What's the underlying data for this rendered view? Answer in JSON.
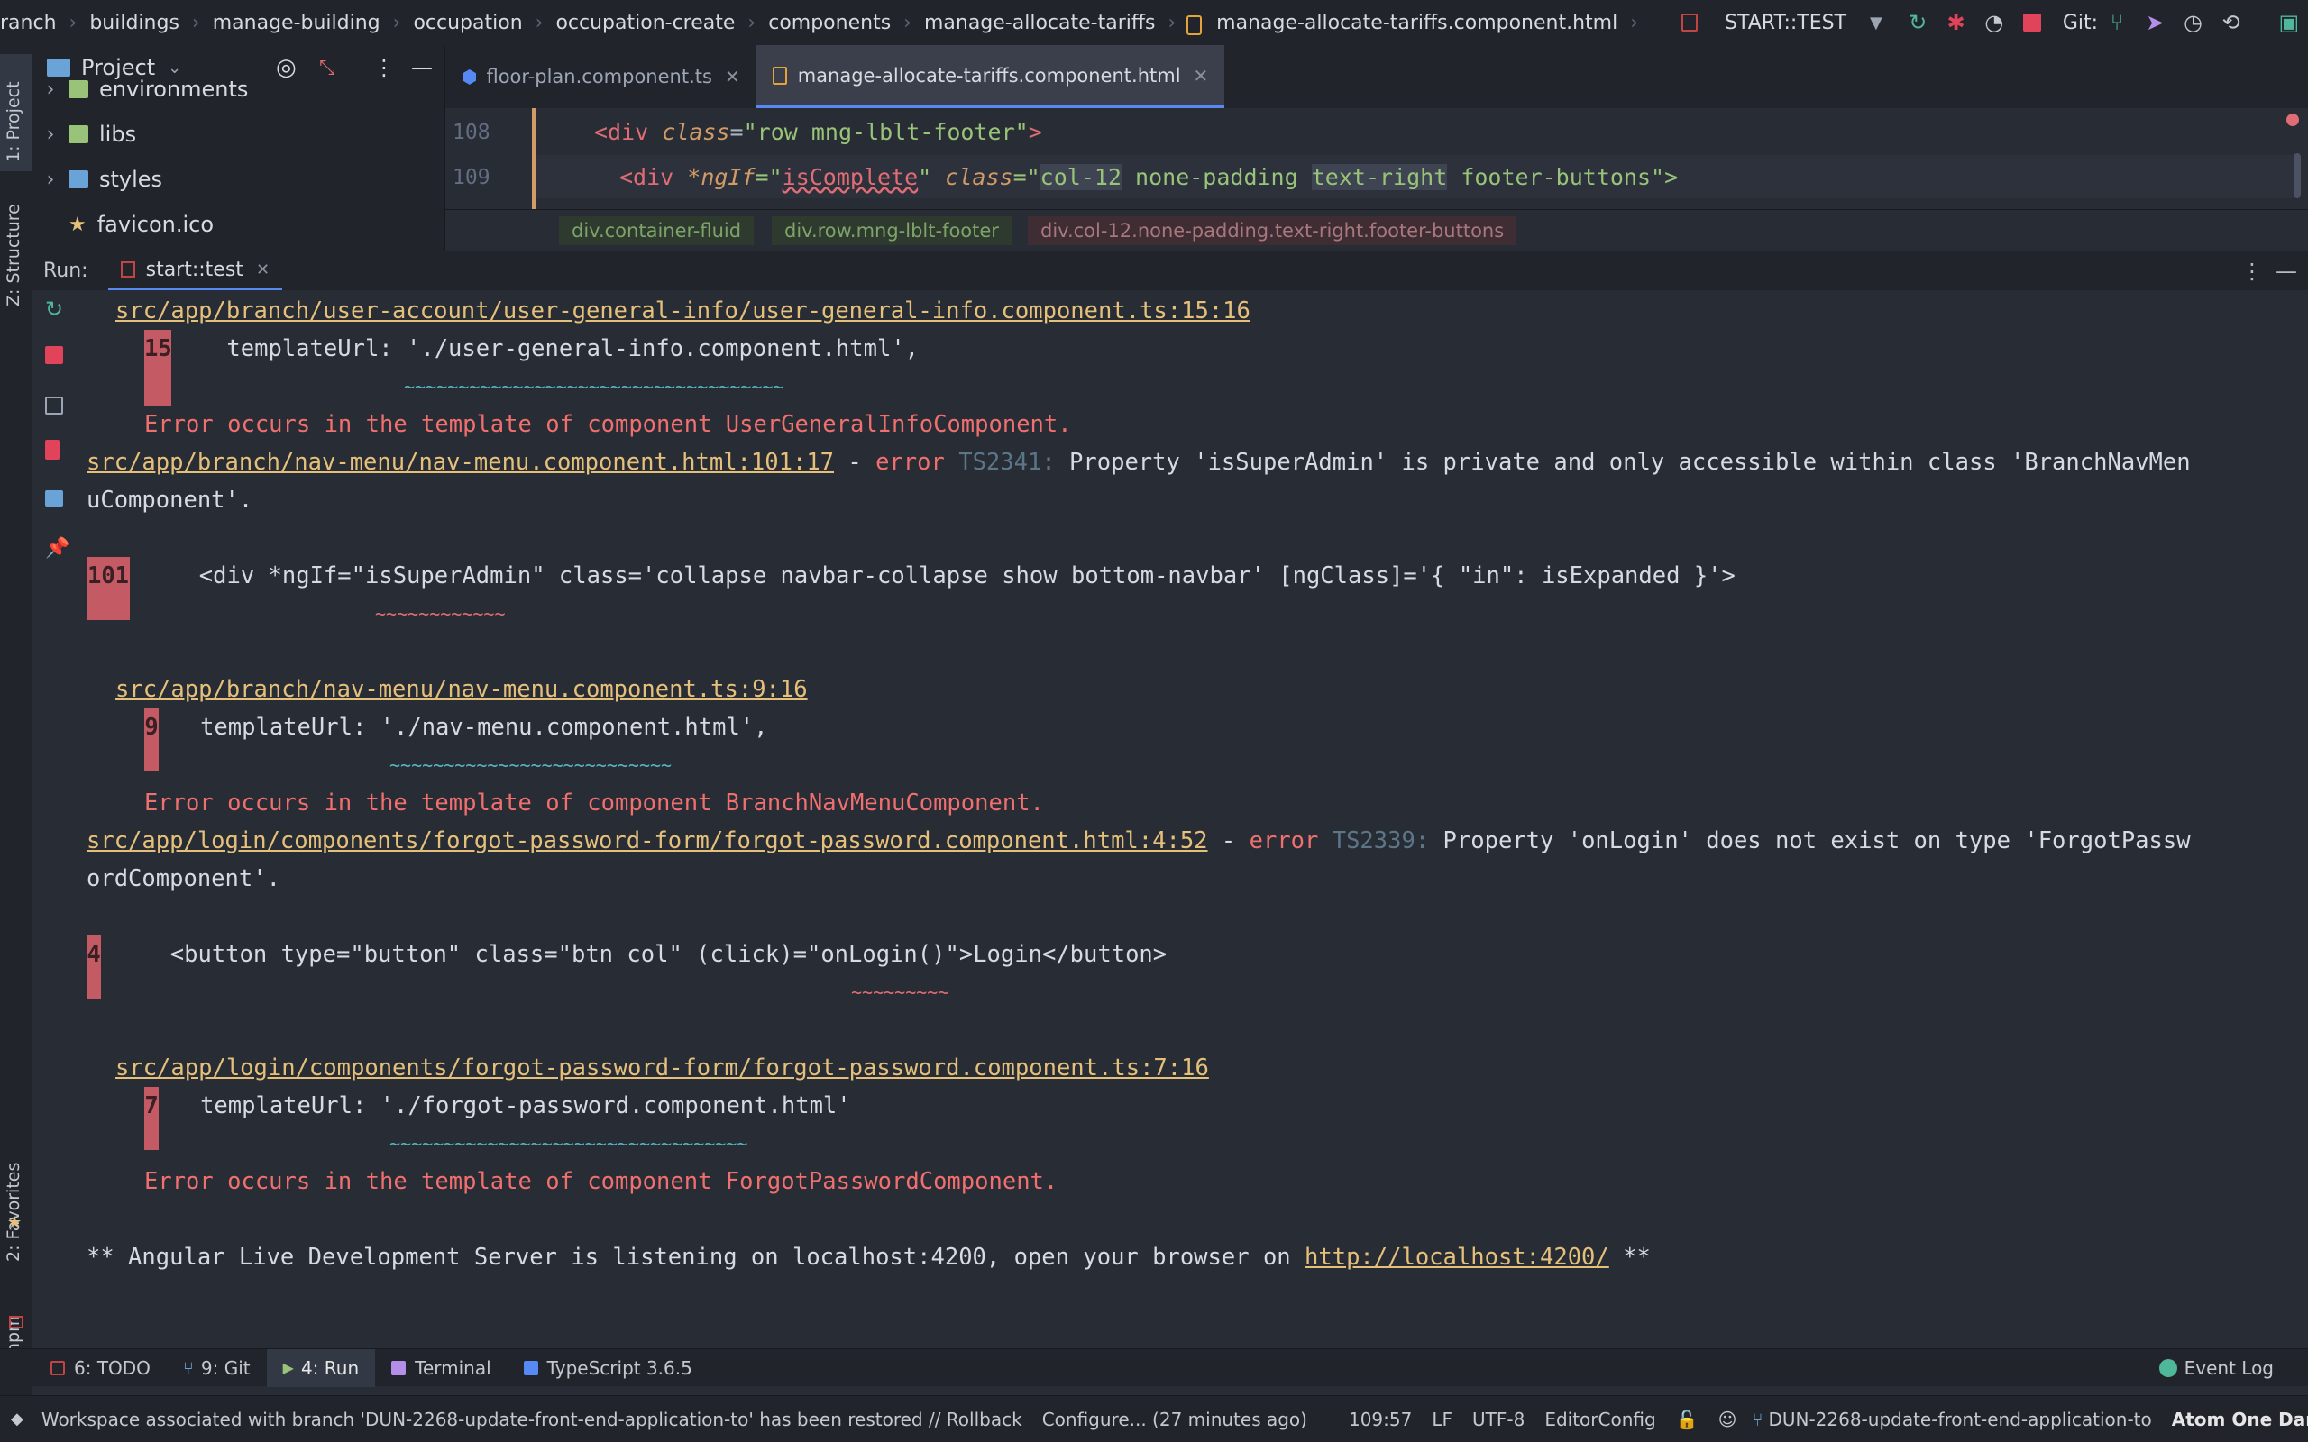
{
  "navbar": {
    "crumbs": [
      "ranch",
      "buildings",
      "manage-building",
      "occupation",
      "occupation-create",
      "components",
      "manage-allocate-tariffs",
      "manage-allocate-tariffs.component.html"
    ],
    "run_config": "START::TEST",
    "git_label": "Git:"
  },
  "left_strip": {
    "project": "1: Project",
    "structure": "Z: Structure",
    "favorites": "2: Favorites",
    "npm": "npm"
  },
  "project_panel": {
    "title": "Project",
    "items": [
      {
        "label": "environments",
        "color": "#98c379"
      },
      {
        "label": "libs",
        "color": "#98c379"
      },
      {
        "label": "styles",
        "color": "#6aa3d8"
      },
      {
        "label": "favicon.ico",
        "color": "#e5c07b"
      }
    ]
  },
  "editor": {
    "tabs": [
      {
        "label": "floor-plan.component.ts",
        "active": false
      },
      {
        "label": "manage-allocate-tariffs.component.html",
        "active": true
      }
    ],
    "lines": [
      {
        "no": "108",
        "tag": "<div",
        "attr1": "class",
        "eq1": "=",
        "val1": "\"row mng-lblt-footer\"",
        "close": ">"
      },
      {
        "no": "109",
        "tag": "<div",
        "attr1": "*ngIf",
        "eq1": "=\"",
        "err": "isComplete",
        "q": "\"",
        "attr2": "class",
        "eq2": "=\"",
        "c1": "col-12",
        "c2": "none-padding",
        "c3": "text-right",
        "c4": "footer-buttons",
        "close": "\">"
      }
    ],
    "breadcrumbs": [
      "div.container-fluid",
      "div.row.mng-lblt-footer",
      "div.col-12.none-padding.text-right.footer-buttons"
    ]
  },
  "run_panel": {
    "label": "Run:",
    "tab": "start::test"
  },
  "console": {
    "l1": "src/app/branch/user-account/user-general-info/user-general-info.component.ts:15:16",
    "l2_no": "15",
    "l2": "templateUrl: './user-general-info.component.html',",
    "l3": "~~~~~~~~~~~~~~~~~~~~~~~~~~~~~~~~~~~",
    "l4": "Error occurs in the template of component UserGeneralInfoComponent.",
    "l5_link": "src/app/branch/nav-menu/nav-menu.component.html:101:17",
    "l5_dash": " - ",
    "l5_err": "error",
    "l5_code": " TS2341:",
    "l5_msg": " Property 'isSuperAdmin' is private and only accessible within class 'BranchNavMen",
    "l6": "uComponent'.",
    "l7_no": "101",
    "l7": "<div *ngIf=\"isSuperAdmin\" class='collapse navbar-collapse show bottom-navbar' [ngClass]='{ \"in\": isExpanded }'>",
    "l8": "~~~~~~~~~~~~",
    "l9": "src/app/branch/nav-menu/nav-menu.component.ts:9:16",
    "l10_no": "9",
    "l10": "templateUrl: './nav-menu.component.html',",
    "l11": "~~~~~~~~~~~~~~~~~~~~~~~~~~",
    "l12": "Error occurs in the template of component BranchNavMenuComponent.",
    "l13_link": "src/app/login/components/forgot-password-form/forgot-password.component.html:4:52",
    "l13_dash": " - ",
    "l13_err": "error",
    "l13_code": " TS2339:",
    "l13_msg": " Property 'onLogin' does not exist on type 'ForgotPassw",
    "l14": "ordComponent'.",
    "l15_no": "4",
    "l15": "<button type=\"button\" class=\"btn col\" (click)=\"onLogin()\">Login</button>",
    "l16": "~~~~~~~~~",
    "l17": "src/app/login/components/forgot-password-form/forgot-password.component.ts:7:16",
    "l18_no": "7",
    "l18": "templateUrl: './forgot-password.component.html'",
    "l19": "~~~~~~~~~~~~~~~~~~~~~~~~~~~~~~~~~",
    "l20": "Error occurs in the template of component ForgotPasswordComponent.",
    "l21_pre": "** Angular Live Development Server is listening on localhost:4200, open your browser on ",
    "l21_link": "http://localhost:4200/",
    "l21_post": " **"
  },
  "toolwindows": {
    "todo": "6: TODO",
    "git": "9: Git",
    "run": "4: Run",
    "terminal": "Terminal",
    "typescript": "TypeScript 3.6.5",
    "event_log": "Event Log"
  },
  "status": {
    "message": "Workspace associated with branch 'DUN-2268-update-front-end-application-to' has been restored // Rollback",
    "configure": "Configure... (27 minutes ago)",
    "position": "109:57",
    "line_sep": "LF",
    "encoding": "UTF-8",
    "editorconfig": "EditorConfig",
    "branch": "DUN-2268-update-front-end-application-to",
    "theme": "Atom One Dark"
  },
  "colors": {
    "accent": "#568af2",
    "error": "#e06c75",
    "link": "#e5c07b",
    "background": "#282c34"
  }
}
